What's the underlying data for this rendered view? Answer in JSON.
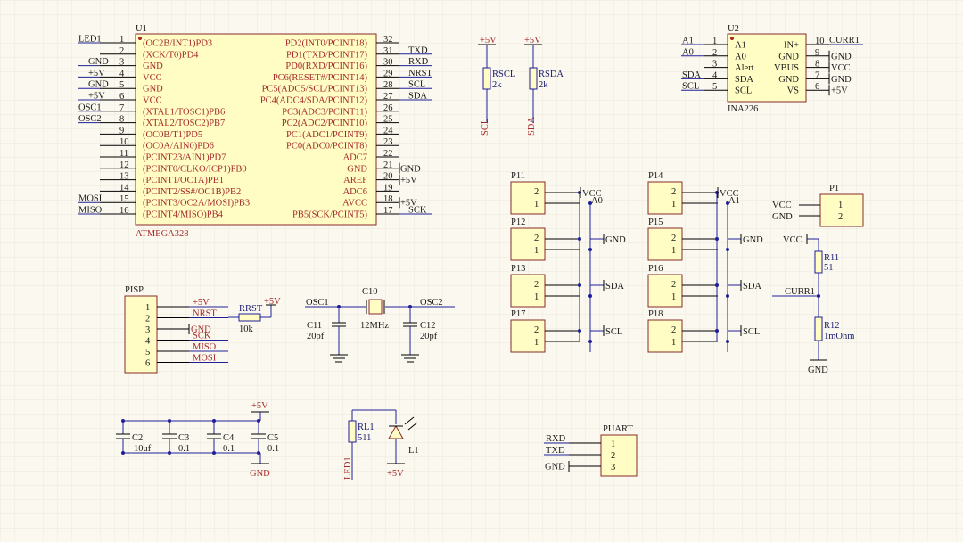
{
  "u1": {
    "ref": "U1",
    "value": "ATMEGA328",
    "left_pins": [
      {
        "num": "1",
        "name": "(OC2B/INT1)PD3",
        "net": "LED1"
      },
      {
        "num": "2",
        "name": "(XCK/T0)PD4",
        "net": ""
      },
      {
        "num": "3",
        "name": "GND",
        "net": "GND"
      },
      {
        "num": "4",
        "name": "VCC",
        "net": "+5V"
      },
      {
        "num": "5",
        "name": "GND",
        "net": "GND"
      },
      {
        "num": "6",
        "name": "VCC",
        "net": "+5V"
      },
      {
        "num": "7",
        "name": "(XTAL1/TOSC1)PB6",
        "net": "OSC1"
      },
      {
        "num": "8",
        "name": "(XTAL2/TOSC2)PB7",
        "net": "OSC2"
      },
      {
        "num": "9",
        "name": "(OC0B/T1)PD5",
        "net": ""
      },
      {
        "num": "10",
        "name": "(OC0A/AIN0)PD6",
        "net": ""
      },
      {
        "num": "11",
        "name": "(PCINT23/AIN1)PD7",
        "net": ""
      },
      {
        "num": "12",
        "name": "(PCINT0/CLKO/ICP1)PB0",
        "net": ""
      },
      {
        "num": "13",
        "name": "(PCINT1/OC1A)PB1",
        "net": ""
      },
      {
        "num": "14",
        "name": "(PCINT2/SS#/OC1B)PB2",
        "net": ""
      },
      {
        "num": "15",
        "name": "(PCINT3/OC2A/MOSI)PB3",
        "net": "MOSI"
      },
      {
        "num": "16",
        "name": "(PCINT4/MISO)PB4",
        "net": "MISO"
      }
    ],
    "right_pins": [
      {
        "num": "32",
        "name": "PD2(INT0/PCINT18)",
        "net": ""
      },
      {
        "num": "31",
        "name": "PD1(TXD/PCINT17)",
        "net": "TXD"
      },
      {
        "num": "30",
        "name": "PD0(RXD/PCINT16)",
        "net": "RXD"
      },
      {
        "num": "29",
        "name": "PC6(RESET#/PCINT14)",
        "net": "NRST"
      },
      {
        "num": "28",
        "name": "PC5(ADC5/SCL/PCINT13)",
        "net": "SCL"
      },
      {
        "num": "27",
        "name": "PC4(ADC4/SDA/PCINT12)",
        "net": "SDA"
      },
      {
        "num": "26",
        "name": "PC3(ADC3/PCINT11)",
        "net": ""
      },
      {
        "num": "25",
        "name": "PC2(ADC2/PCINT10)",
        "net": ""
      },
      {
        "num": "24",
        "name": "PC1(ADC1/PCINT9)",
        "net": ""
      },
      {
        "num": "23",
        "name": "PC0(ADC0/PCINT8)",
        "net": ""
      },
      {
        "num": "22",
        "name": "ADC7",
        "net": ""
      },
      {
        "num": "21",
        "name": "GND",
        "net": "GND"
      },
      {
        "num": "20",
        "name": "AREF",
        "net": "+5V"
      },
      {
        "num": "19",
        "name": "ADC6",
        "net": ""
      },
      {
        "num": "18",
        "name": "AVCC",
        "net": "+5V"
      },
      {
        "num": "17",
        "name": "PB5(SCK/PCINT5)",
        "net": "SCK"
      }
    ]
  },
  "u2": {
    "ref": "U2",
    "value": "INA226",
    "left_pins": [
      {
        "num": "1",
        "name": "A1",
        "net": "A1"
      },
      {
        "num": "2",
        "name": "A0",
        "net": "A0"
      },
      {
        "num": "3",
        "name": "Alert",
        "net": ""
      },
      {
        "num": "4",
        "name": "SDA",
        "net": "SDA"
      },
      {
        "num": "5",
        "name": "SCL",
        "net": "SCL"
      }
    ],
    "right_pins": [
      {
        "num": "10",
        "name": "IN+",
        "net": "CURR1"
      },
      {
        "num": "9",
        "name": "GND",
        "net": "GND"
      },
      {
        "num": "8",
        "name": "VBUS",
        "net": "VCC"
      },
      {
        "num": "7",
        "name": "GND",
        "net": "GND"
      },
      {
        "num": "6",
        "name": "VS",
        "net": "+5V"
      }
    ]
  },
  "pullups": [
    {
      "ref": "RSCL",
      "value": "2k",
      "top": "+5V",
      "bottom": "SCL"
    },
    {
      "ref": "RSDA",
      "value": "2k",
      "top": "+5V",
      "bottom": "SDA"
    }
  ],
  "headers_left": [
    {
      "ref": "P11",
      "pins": [
        "2",
        "1"
      ],
      "net": "VCC",
      "net2": "A0"
    },
    {
      "ref": "P12",
      "pins": [
        "2",
        "1"
      ],
      "net": "GND"
    },
    {
      "ref": "P13",
      "pins": [
        "2",
        "1"
      ],
      "net": "SDA"
    },
    {
      "ref": "P17",
      "pins": [
        "2",
        "1"
      ],
      "net": "SCL"
    }
  ],
  "headers_right": [
    {
      "ref": "P14",
      "pins": [
        "2",
        "1"
      ],
      "net": "VCC",
      "net2": "A1"
    },
    {
      "ref": "P15",
      "pins": [
        "2",
        "1"
      ],
      "net": "GND"
    },
    {
      "ref": "P16",
      "pins": [
        "2",
        "1"
      ],
      "net": "SDA"
    },
    {
      "ref": "P18",
      "pins": [
        "2",
        "1"
      ],
      "net": "SCL"
    }
  ],
  "p1": {
    "ref": "P1",
    "pins": [
      {
        "num": "1",
        "net": "VCC"
      },
      {
        "num": "2",
        "net": "GND"
      }
    ]
  },
  "shunt": {
    "vcc": "VCC",
    "curr": "CURR1",
    "gnd": "GND",
    "r11": {
      "ref": "R11",
      "value": "51"
    },
    "r12": {
      "ref": "R12",
      "value": "1mOhm"
    }
  },
  "pisp": {
    "ref": "PISP",
    "pins": [
      {
        "num": "1",
        "net": "+5V"
      },
      {
        "num": "2",
        "net": "NRST"
      },
      {
        "num": "3",
        "net": "GND"
      },
      {
        "num": "4",
        "net": "SCK"
      },
      {
        "num": "5",
        "net": "MISO"
      },
      {
        "num": "6",
        "net": "MOSI"
      }
    ],
    "rrst": {
      "ref": "RRST",
      "value": "10k",
      "net": "+5V"
    }
  },
  "crystal": {
    "osc1": "OSC1",
    "osc2": "OSC2",
    "c10": {
      "ref": "C10",
      "value": "12MHz"
    },
    "c11": {
      "ref": "C11",
      "value": "20pf"
    },
    "c12": {
      "ref": "C12",
      "value": "20pf"
    }
  },
  "decoupling": {
    "top": "+5V",
    "bottom": "GND",
    "caps": [
      {
        "ref": "C2",
        "value": "10uf"
      },
      {
        "ref": "C3",
        "value": "0.1"
      },
      {
        "ref": "C4",
        "value": "0.1"
      },
      {
        "ref": "C5",
        "value": "0.1"
      }
    ]
  },
  "led": {
    "rl1": {
      "ref": "RL1",
      "value": "511"
    },
    "l1": "L1",
    "net": "LED1",
    "supply": "+5V"
  },
  "puart": {
    "ref": "PUART",
    "pins": [
      {
        "num": "1",
        "net": "RXD"
      },
      {
        "num": "2",
        "net": "TXD"
      },
      {
        "num": "3",
        "net": "GND"
      }
    ]
  },
  "colors": {
    "background": "#fbf9ef",
    "grid": "#e6e3d6",
    "part_fill": "#fffcc4",
    "part_border": "#8a2a2a",
    "wire": "#1f1f9a",
    "pin_name": "#a52a2a",
    "text": "#1a1a1a"
  }
}
